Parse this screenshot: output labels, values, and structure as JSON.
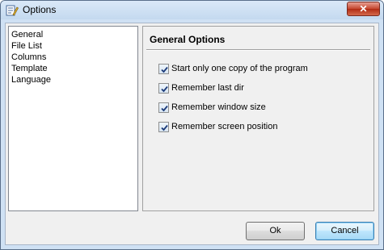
{
  "window": {
    "title": "Options",
    "close_label": "✕"
  },
  "sidebar": {
    "items": [
      {
        "label": "General"
      },
      {
        "label": "File List"
      },
      {
        "label": "Columns"
      },
      {
        "label": "Template"
      },
      {
        "label": "Language"
      }
    ]
  },
  "panel": {
    "title": "General Options",
    "options": [
      {
        "label": "Start only one copy of the program",
        "checked": true
      },
      {
        "label": "Remember last dir",
        "checked": true
      },
      {
        "label": "Remember window size",
        "checked": true
      },
      {
        "label": "Remember screen position",
        "checked": true
      }
    ]
  },
  "buttons": {
    "ok_label": "Ok",
    "cancel_label": "Cancel"
  }
}
